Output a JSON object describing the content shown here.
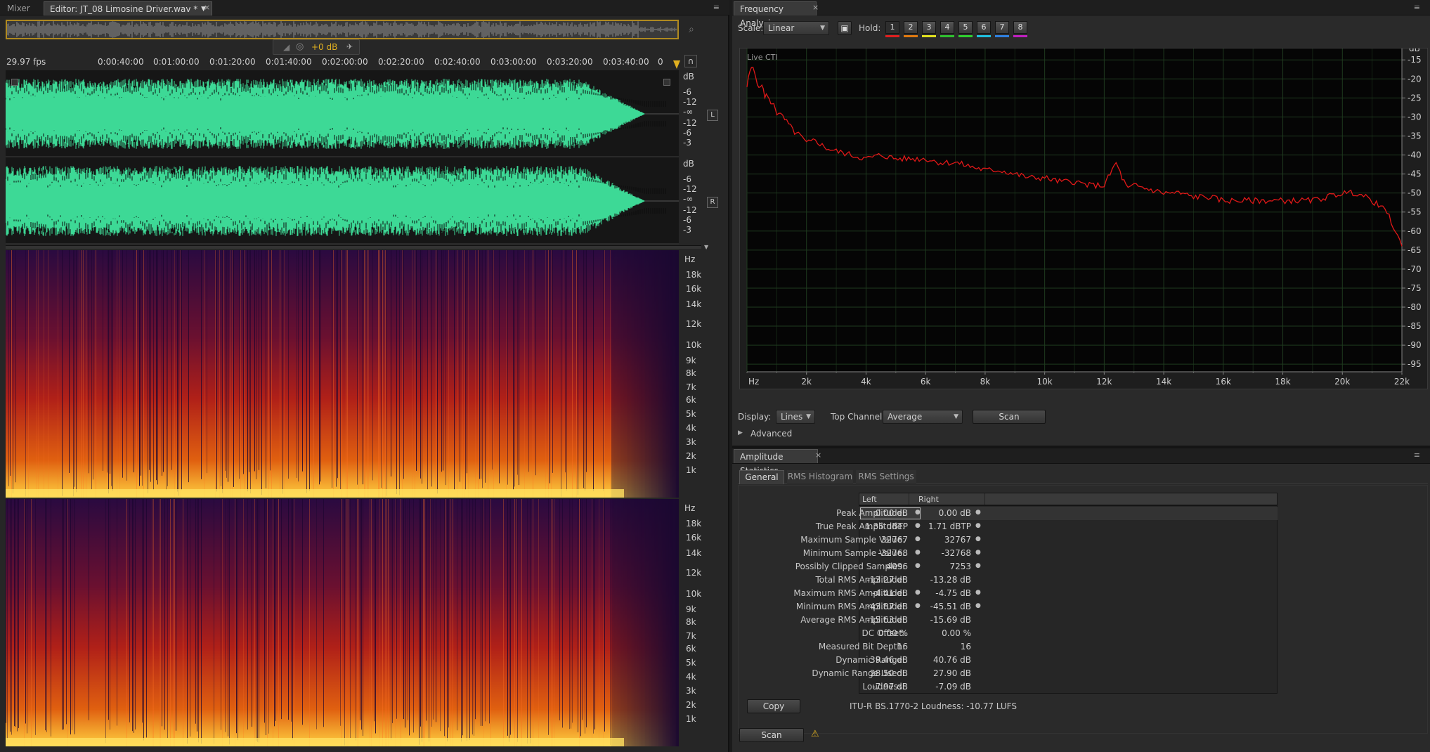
{
  "editor": {
    "tabs": [
      {
        "label": "Mixer"
      },
      {
        "label": "Editor: JT_08 Limosine Driver.wav *"
      }
    ],
    "fps": "29.97 fps",
    "hud_gain": "+0 dB",
    "timeline": [
      "0:00:40:00",
      "0:01:00:00",
      "0:01:20:00",
      "0:01:40:00",
      "0:02:00:00",
      "0:02:20:00",
      "0:02:40:00",
      "0:03:00:00",
      "0:03:20:00",
      "0:03:40:00"
    ],
    "timeline_prefix": "0",
    "db_scale": [
      "dB",
      "-6",
      "-12",
      "-∞",
      "-12",
      "-6",
      "-3"
    ],
    "channel_left": "L",
    "channel_right": "R",
    "hz_label": "Hz",
    "hz_scale": [
      "18k",
      "16k",
      "14k",
      "12k",
      "10k",
      "9k",
      "8k",
      "7k",
      "6k",
      "5k",
      "4k",
      "3k",
      "2k",
      "1k"
    ],
    "waveform_color": "#3dd996"
  },
  "freq": {
    "title": "Frequency Analysis",
    "scale_label": "Scale:",
    "scale_value": "Linear",
    "hold_label": "Hold:",
    "holds": [
      {
        "n": "1",
        "color": "#e02020"
      },
      {
        "n": "2",
        "color": "#e07a10"
      },
      {
        "n": "3",
        "color": "#e0e020"
      },
      {
        "n": "4",
        "color": "#30c030"
      },
      {
        "n": "5",
        "color": "#30d030"
      },
      {
        "n": "6",
        "color": "#20c0e0"
      },
      {
        "n": "7",
        "color": "#3080e0"
      },
      {
        "n": "8",
        "color": "#c020c0"
      }
    ],
    "live_label": "Live CTI",
    "db_unit": "dB",
    "db_ticks": [
      "-15",
      "-20",
      "-25",
      "-30",
      "-35",
      "-40",
      "-45",
      "-50",
      "-55",
      "-60",
      "-65",
      "-70",
      "-75",
      "-80",
      "-85",
      "-90",
      "-95"
    ],
    "hz_unit": "Hz",
    "hz_ticks": [
      "2k",
      "4k",
      "6k",
      "8k",
      "10k",
      "12k",
      "14k",
      "16k",
      "18k",
      "20k",
      "22k"
    ],
    "display_label": "Display:",
    "display_value": "Lines",
    "top_channel_label": "Top Channel:",
    "top_channel_value": "Average",
    "scan_label": "Scan",
    "advanced_label": "Advanced",
    "line_color": "#e01818",
    "chart_data": {
      "type": "line",
      "xlabel": "Hz",
      "ylabel": "dB",
      "xlim": [
        0,
        22000
      ],
      "ylim": [
        -97,
        -12
      ],
      "series": [
        {
          "x": [
            0,
            100,
            200,
            300,
            400,
            500,
            600,
            700,
            800,
            900,
            1000,
            1200,
            1400,
            1600,
            1800,
            2000,
            2300,
            2600,
            3000,
            3500,
            4000,
            4500,
            5000,
            5500,
            6000,
            6500,
            7000,
            7500,
            8000,
            8500,
            9000,
            9500,
            10000,
            10500,
            11000,
            11500,
            12000,
            12200,
            12400,
            12600,
            12800,
            13000,
            13500,
            14000,
            14500,
            15000,
            15500,
            16000,
            16500,
            17000,
            17500,
            18000,
            18500,
            19000,
            19500,
            20000,
            20500,
            21000,
            21500,
            22000
          ],
          "y": [
            -22,
            -18,
            -17,
            -19,
            -23,
            -21,
            -25,
            -24,
            -27,
            -26,
            -29,
            -30,
            -32,
            -34,
            -35,
            -37,
            -36,
            -38,
            -39,
            -40,
            -41,
            -40,
            -41,
            -41,
            -41,
            -42,
            -42,
            -43,
            -44,
            -44,
            -45,
            -46,
            -46,
            -47,
            -47,
            -48,
            -48,
            -45,
            -42,
            -46,
            -49,
            -48,
            -49,
            -50,
            -50,
            -51,
            -51,
            -52,
            -52,
            -52,
            -52,
            -52,
            -52,
            -52,
            -51,
            -50,
            -50,
            -52,
            -55,
            -64
          ]
        }
      ]
    }
  },
  "amp": {
    "title": "Amplitude Statistics",
    "tabs": [
      {
        "label": "General"
      },
      {
        "label": "RMS Histogram"
      },
      {
        "label": "RMS Settings"
      }
    ],
    "col_left": "Left",
    "col_right": "Right",
    "rows": [
      {
        "name": "Peak Amplitude:",
        "left": "0.00 dB",
        "right": "0.00 dB"
      },
      {
        "name": "True Peak Amplitude:",
        "left": "1.35 dBTP",
        "right": "1.71 dBTP"
      },
      {
        "name": "Maximum Sample Value:",
        "left": "32767",
        "right": "32767"
      },
      {
        "name": "Minimum Sample Value:",
        "left": "-32768",
        "right": "-32768"
      },
      {
        "name": "Possibly Clipped Samples:",
        "left": "4096",
        "right": "7253"
      },
      {
        "name": "Total RMS Amplitude:",
        "left": "-13.27 dB",
        "right": "-13.28 dB"
      },
      {
        "name": "Maximum RMS Amplitude:",
        "left": "-4.41 dB",
        "right": "-4.75 dB"
      },
      {
        "name": "Minimum RMS Amplitude:",
        "left": "-43.87 dB",
        "right": "-45.51 dB"
      },
      {
        "name": "Average RMS Amplitude:",
        "left": "-15.63 dB",
        "right": "-15.69 dB"
      },
      {
        "name": "DC Offset:",
        "left": "0.00 %",
        "right": "0.00 %"
      },
      {
        "name": "Measured Bit Depth:",
        "left": "16",
        "right": "16"
      },
      {
        "name": "Dynamic Range:",
        "left": "39.46 dB",
        "right": "40.76 dB"
      },
      {
        "name": "Dynamic Range Used:",
        "left": "28.50 dB",
        "right": "27.90 dB"
      },
      {
        "name": "Loudness:",
        "left": "-7.97 dB",
        "right": "-7.09 dB"
      }
    ],
    "copy_label": "Copy",
    "loudness_text": "ITU-R BS.1770-2 Loudness: -10.77 LUFS",
    "scan_label": "Scan"
  }
}
